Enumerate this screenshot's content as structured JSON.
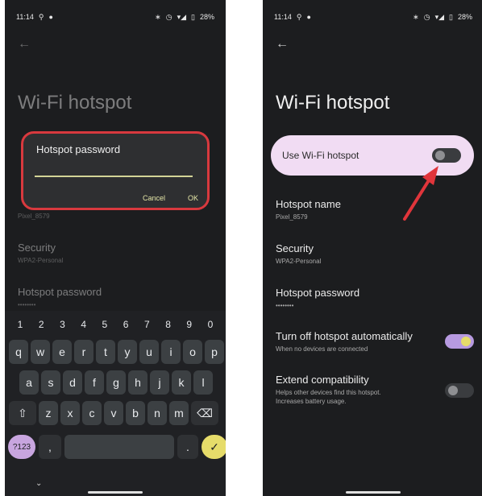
{
  "left": {
    "status": {
      "time": "11:14",
      "battery": "28%"
    },
    "title": "Wi-Fi hotspot",
    "dialog": {
      "title": "Hotspot password",
      "cancel_label": "Cancel",
      "ok_label": "OK"
    },
    "background_items": {
      "hotspot_name_value": "Pixel_8579",
      "security_title": "Security",
      "security_value": "WPA2-Personal",
      "hotspot_password_title": "Hotspot password",
      "hotspot_password_value": "••••••••"
    },
    "keyboard": {
      "numbers": [
        "1",
        "2",
        "3",
        "4",
        "5",
        "6",
        "7",
        "8",
        "9",
        "0"
      ],
      "row1": [
        "q",
        "w",
        "e",
        "r",
        "t",
        "y",
        "u",
        "i",
        "o",
        "p"
      ],
      "row2": [
        "a",
        "s",
        "d",
        "f",
        "g",
        "h",
        "j",
        "k",
        "l"
      ],
      "row3": [
        "z",
        "x",
        "c",
        "v",
        "b",
        "n",
        "m"
      ],
      "symbols_label": "?123",
      "comma_label": ",",
      "period_label": "."
    }
  },
  "right": {
    "status": {
      "time": "11:14",
      "battery": "28%"
    },
    "title": "Wi-Fi hotspot",
    "use_hotspot": {
      "label": "Use Wi-Fi hotspot",
      "on": false
    },
    "hotspot_name": {
      "title": "Hotspot name",
      "value": "Pixel_8579"
    },
    "security": {
      "title": "Security",
      "value": "WPA2-Personal"
    },
    "hotspot_password": {
      "title": "Hotspot password",
      "value": "••••••••"
    },
    "turn_off_auto": {
      "title": "Turn off hotspot automatically",
      "subtitle": "When no devices are connected",
      "on": true
    },
    "extend_compat": {
      "title": "Extend compatibility",
      "subtitle_line1": "Helps other devices find this hotspot.",
      "subtitle_line2": "Increases battery usage.",
      "on": false
    }
  },
  "colors": {
    "phone_bg": "#1c1d1f",
    "dialog_border": "#d8393e",
    "accent_yellow": "#e6dc6a",
    "card_pink": "#f1dcf3",
    "arrow_red": "#e0353b",
    "toggle_on_track": "#b79ae0"
  }
}
